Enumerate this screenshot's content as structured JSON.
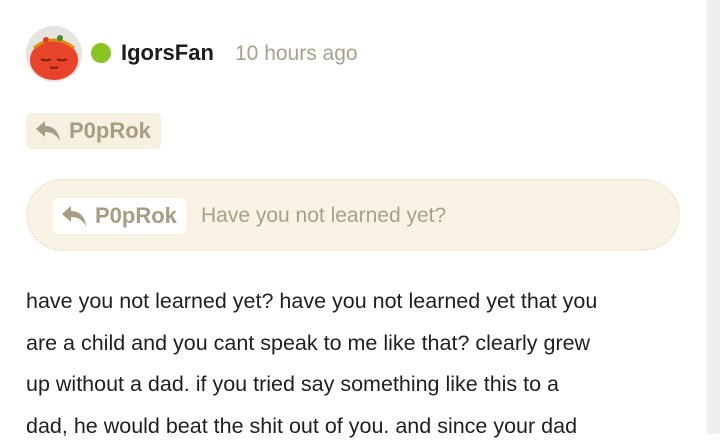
{
  "post": {
    "author": "IgorsFan",
    "timestamp": "10 hours ago",
    "online_status": "online",
    "reply_to": {
      "label": "P0pRok",
      "icon": "reply-arrow-icon"
    },
    "quote": {
      "author": "P0pRok",
      "text": "Have you not learned yet?",
      "icon": "reply-arrow-icon"
    },
    "body_lines": [
      "have you not learned yet? have you not learned yet that you",
      "are a child and you cant speak to me like that? clearly grew",
      "up without a dad. if you tried say something like this to a",
      "dad, he would beat the shit out of you. and since your dad"
    ]
  },
  "colors": {
    "online": "#8bc320",
    "muted_text": "#a7a08a",
    "chip_bg": "#f6f0e0",
    "quote_bg": "#f8f3e4"
  }
}
